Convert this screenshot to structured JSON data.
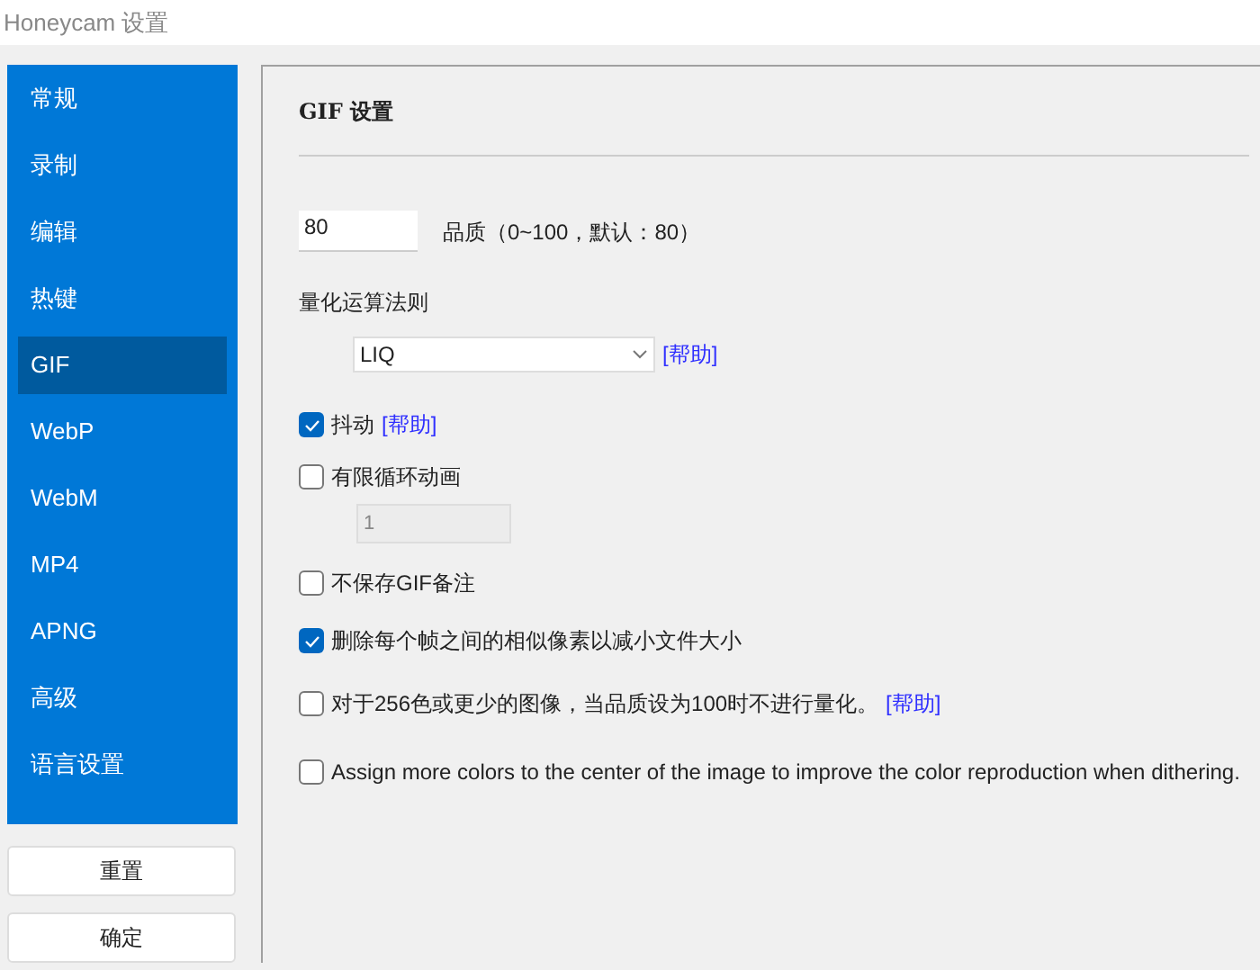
{
  "window": {
    "title": "Honeycam 设置"
  },
  "sidebar": {
    "items": [
      {
        "label": "常规",
        "selected": false
      },
      {
        "label": "录制",
        "selected": false
      },
      {
        "label": "编辑",
        "selected": false
      },
      {
        "label": "热键",
        "selected": false
      },
      {
        "label": "GIF",
        "selected": true
      },
      {
        "label": "WebP",
        "selected": false
      },
      {
        "label": "WebM",
        "selected": false
      },
      {
        "label": "MP4",
        "selected": false
      },
      {
        "label": "APNG",
        "selected": false
      },
      {
        "label": "高级",
        "selected": false
      },
      {
        "label": "语言设置",
        "selected": false
      }
    ]
  },
  "buttons": [
    "重置",
    "确定"
  ],
  "panel": {
    "heading": "GIF 设置",
    "quality": {
      "value": "80",
      "label": "品质（0~100，默认：80）"
    },
    "algorithm": {
      "label": "量化运算法则",
      "value": "LIQ",
      "help": "[帮助]"
    },
    "options": [
      {
        "kind": "checkbox",
        "label": "抖动",
        "checked": true,
        "help": "[帮助]"
      },
      {
        "kind": "checkbox",
        "label": "有限循环动画",
        "checked": false
      },
      {
        "kind": "count",
        "value": "1",
        "disabled": true
      },
      {
        "kind": "checkbox",
        "label": "不保存GIF备注",
        "checked": false
      },
      {
        "kind": "checkbox",
        "label": "删除每个帧之间的相似像素以减小文件大小",
        "checked": true
      },
      {
        "kind": "checkbox",
        "label": "对于256色或更少的图像，当品质设为100时不进行量化。",
        "checked": false,
        "help": "[帮助]"
      },
      {
        "kind": "checkbox",
        "label": "Assign more colors to the center of the image to improve the color reproduction when dithering.",
        "checked": false
      }
    ]
  }
}
